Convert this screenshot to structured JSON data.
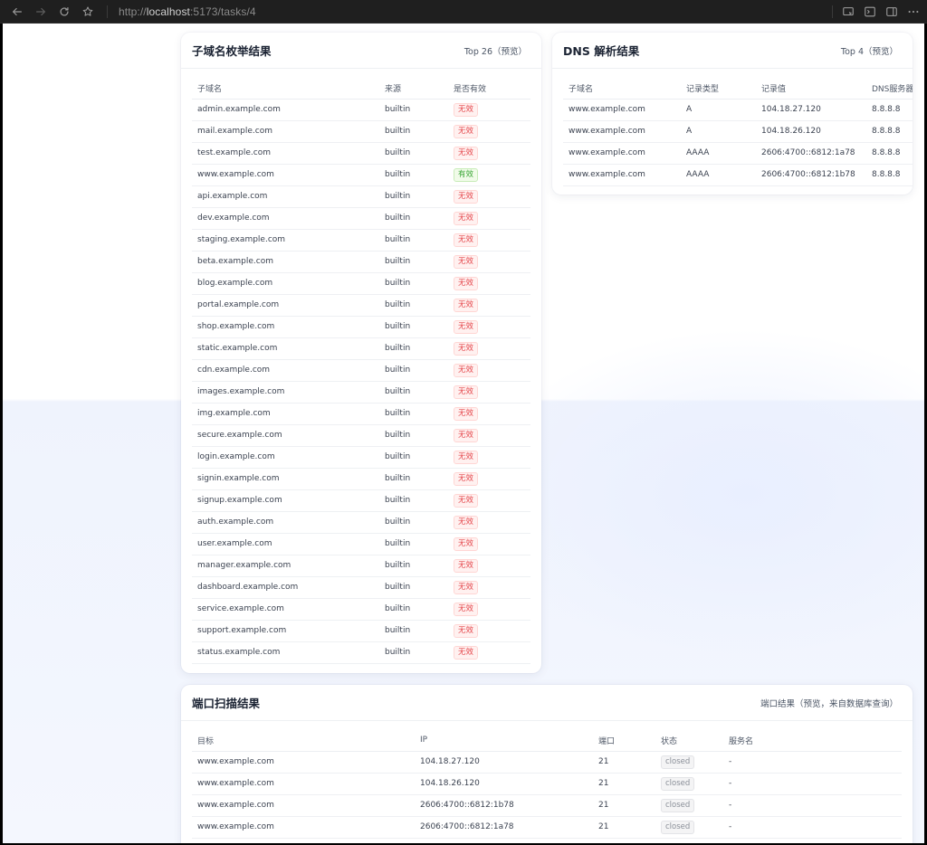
{
  "browser": {
    "url_prefix": "http://",
    "url_host": "localhost",
    "url_rest": ":5173/tasks/4"
  },
  "subdomain_card": {
    "title": "子域名枚举结果",
    "extra": "Top 26（预览）",
    "columns": [
      "子域名",
      "来源",
      "是否有效"
    ],
    "rows": [
      {
        "name": "admin.example.com",
        "source": "builtin",
        "valid": "无效",
        "status": "bad"
      },
      {
        "name": "mail.example.com",
        "source": "builtin",
        "valid": "无效",
        "status": "bad"
      },
      {
        "name": "test.example.com",
        "source": "builtin",
        "valid": "无效",
        "status": "bad"
      },
      {
        "name": "www.example.com",
        "source": "builtin",
        "valid": "有效",
        "status": "good"
      },
      {
        "name": "api.example.com",
        "source": "builtin",
        "valid": "无效",
        "status": "bad"
      },
      {
        "name": "dev.example.com",
        "source": "builtin",
        "valid": "无效",
        "status": "bad"
      },
      {
        "name": "staging.example.com",
        "source": "builtin",
        "valid": "无效",
        "status": "bad"
      },
      {
        "name": "beta.example.com",
        "source": "builtin",
        "valid": "无效",
        "status": "bad"
      },
      {
        "name": "blog.example.com",
        "source": "builtin",
        "valid": "无效",
        "status": "bad"
      },
      {
        "name": "portal.example.com",
        "source": "builtin",
        "valid": "无效",
        "status": "bad"
      },
      {
        "name": "shop.example.com",
        "source": "builtin",
        "valid": "无效",
        "status": "bad"
      },
      {
        "name": "static.example.com",
        "source": "builtin",
        "valid": "无效",
        "status": "bad"
      },
      {
        "name": "cdn.example.com",
        "source": "builtin",
        "valid": "无效",
        "status": "bad"
      },
      {
        "name": "images.example.com",
        "source": "builtin",
        "valid": "无效",
        "status": "bad"
      },
      {
        "name": "img.example.com",
        "source": "builtin",
        "valid": "无效",
        "status": "bad"
      },
      {
        "name": "secure.example.com",
        "source": "builtin",
        "valid": "无效",
        "status": "bad"
      },
      {
        "name": "login.example.com",
        "source": "builtin",
        "valid": "无效",
        "status": "bad"
      },
      {
        "name": "signin.example.com",
        "source": "builtin",
        "valid": "无效",
        "status": "bad"
      },
      {
        "name": "signup.example.com",
        "source": "builtin",
        "valid": "无效",
        "status": "bad"
      },
      {
        "name": "auth.example.com",
        "source": "builtin",
        "valid": "无效",
        "status": "bad"
      },
      {
        "name": "user.example.com",
        "source": "builtin",
        "valid": "无效",
        "status": "bad"
      },
      {
        "name": "manager.example.com",
        "source": "builtin",
        "valid": "无效",
        "status": "bad"
      },
      {
        "name": "dashboard.example.com",
        "source": "builtin",
        "valid": "无效",
        "status": "bad"
      },
      {
        "name": "service.example.com",
        "source": "builtin",
        "valid": "无效",
        "status": "bad"
      },
      {
        "name": "support.example.com",
        "source": "builtin",
        "valid": "无效",
        "status": "bad"
      },
      {
        "name": "status.example.com",
        "source": "builtin",
        "valid": "无效",
        "status": "bad"
      }
    ]
  },
  "dns_card": {
    "title": "DNS 解析结果",
    "extra": "Top 4（预览）",
    "columns": [
      "子域名",
      "记录类型",
      "记录值",
      "DNS服务器"
    ],
    "rows": [
      {
        "name": "www.example.com",
        "type": "A",
        "value": "104.18.27.120",
        "server": "8.8.8.8"
      },
      {
        "name": "www.example.com",
        "type": "A",
        "value": "104.18.26.120",
        "server": "8.8.8.8"
      },
      {
        "name": "www.example.com",
        "type": "AAAA",
        "value": "2606:4700::6812:1a78",
        "server": "8.8.8.8"
      },
      {
        "name": "www.example.com",
        "type": "AAAA",
        "value": "2606:4700::6812:1b78",
        "server": "8.8.8.8"
      }
    ]
  },
  "port_card": {
    "title": "端口扫描结果",
    "extra": "端口结果（预览，来自数据库查询）",
    "columns": [
      "目标",
      "IP",
      "端口",
      "状态",
      "服务名"
    ],
    "rows": [
      {
        "target": "www.example.com",
        "ip": "104.18.27.120",
        "port": "21",
        "state": "closed",
        "service": "-"
      },
      {
        "target": "www.example.com",
        "ip": "104.18.26.120",
        "port": "21",
        "state": "closed",
        "service": "-"
      },
      {
        "target": "www.example.com",
        "ip": "2606:4700::6812:1b78",
        "port": "21",
        "state": "closed",
        "service": "-"
      },
      {
        "target": "www.example.com",
        "ip": "2606:4700::6812:1a78",
        "port": "21",
        "state": "closed",
        "service": "-"
      }
    ]
  }
}
